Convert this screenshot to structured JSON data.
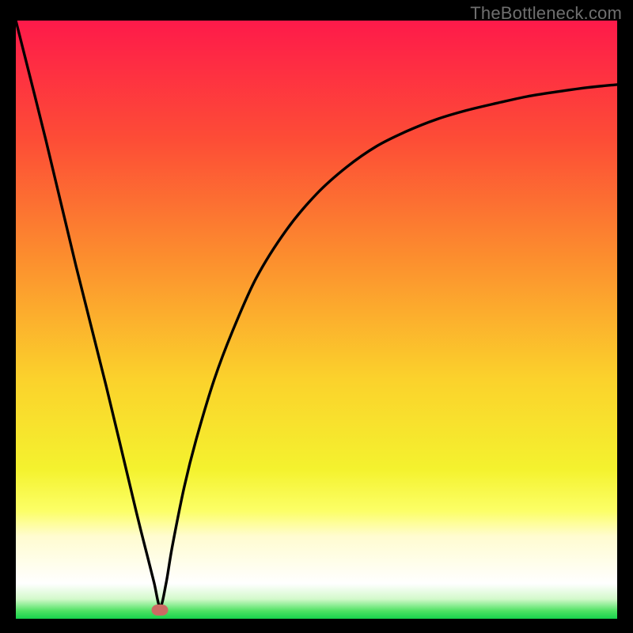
{
  "watermark": "TheBottleneck.com",
  "chart_data": {
    "type": "line",
    "title": "",
    "xlabel": "",
    "ylabel": "",
    "xlim": [
      0,
      100
    ],
    "ylim": [
      0,
      100
    ],
    "vertex_x": 24,
    "marker": {
      "x": 24,
      "y": 1.5,
      "color": "#cb6b63"
    },
    "series": [
      {
        "name": "bottleneck-curve",
        "x": [
          0,
          5,
          10,
          15,
          20,
          22,
          23,
          24,
          25,
          26,
          28,
          30,
          33,
          36,
          40,
          45,
          50,
          55,
          60,
          65,
          70,
          75,
          80,
          85,
          90,
          95,
          100
        ],
        "y": [
          100,
          80,
          59,
          39,
          18,
          10,
          6,
          2,
          6,
          12,
          22,
          30,
          40,
          48,
          57,
          65,
          71,
          75.5,
          79,
          81.5,
          83.5,
          85,
          86.2,
          87.3,
          88.1,
          88.8,
          89.3
        ]
      }
    ],
    "background_gradient": {
      "stops": [
        {
          "offset": 0.0,
          "color": "#fe1a4a"
        },
        {
          "offset": 0.2,
          "color": "#fd4d36"
        },
        {
          "offset": 0.4,
          "color": "#fc8f2e"
        },
        {
          "offset": 0.6,
          "color": "#fbd22c"
        },
        {
          "offset": 0.75,
          "color": "#f4f22e"
        },
        {
          "offset": 0.82,
          "color": "#fcff67"
        },
        {
          "offset": 0.862,
          "color": "#fffcd0"
        },
        {
          "offset": 0.941,
          "color": "#ffffff"
        },
        {
          "offset": 0.967,
          "color": "#d3f9cb"
        },
        {
          "offset": 0.987,
          "color": "#4ee263"
        },
        {
          "offset": 1.0,
          "color": "#17d24c"
        }
      ]
    }
  }
}
